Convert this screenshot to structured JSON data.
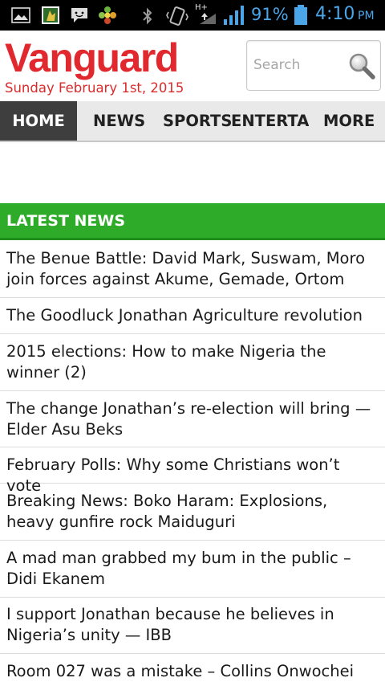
{
  "status_bar": {
    "network_type": "H+",
    "battery": "91%",
    "time": "4:10",
    "ampm": "PM",
    "icons": [
      "gallery-icon",
      "app-icon",
      "messenger-icon",
      "flower-icon",
      "bluetooth-icon",
      "vibrate-icon",
      "data-arrows-icon",
      "signal-icon",
      "battery-icon"
    ]
  },
  "header": {
    "logo": "Vanguard",
    "date": "Sunday February 1st, 2015",
    "search_placeholder": "Search"
  },
  "nav": {
    "tabs": [
      {
        "label": "HOME",
        "active": true
      },
      {
        "label": "NEWS",
        "active": false
      },
      {
        "label": "SPORTS",
        "active": false
      },
      {
        "label": "ENTERTAINMENT",
        "active": false
      },
      {
        "label": "MORE",
        "active": false
      }
    ]
  },
  "section": {
    "title": "LATEST NEWS"
  },
  "news": [
    "The Benue Battle: David Mark, Suswam, Moro join forces against Akume, Gemade, Ortom",
    "The Goodluck Jonathan Agriculture revolution",
    "2015 elections: How to make Nigeria the winner (2)",
    "The change Jonathan’s re-election will bring — Elder Asu Beks",
    "February Polls: Why some Christians won’t vote",
    "Breaking News: Boko Haram: Explosions, heavy gunfire rock Maiduguri",
    "A mad man grabbed my bum in the public – Didi Ekanem",
    "I support Jonathan because he believes in Nigeria’s unity — IBB",
    "Room 027 was a mistake – Collins Onwochei"
  ],
  "colors": {
    "brand_red": "#e0282e",
    "section_green": "#2eab28",
    "nav_active": "#3e3e3e"
  }
}
